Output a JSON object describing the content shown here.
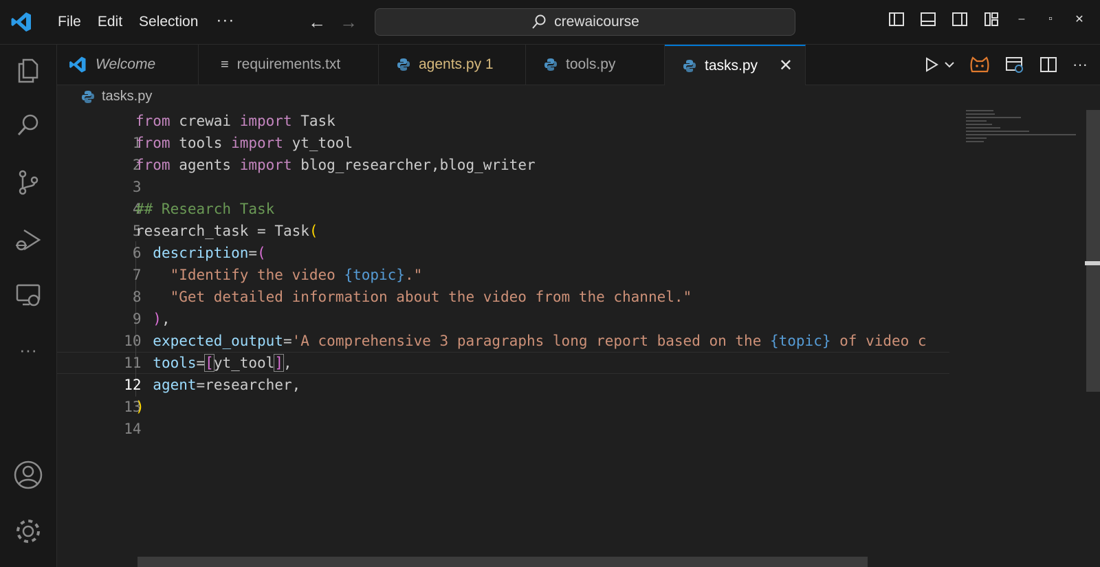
{
  "menu": [
    "File",
    "Edit",
    "Selection"
  ],
  "search": {
    "label": "crewaicourse"
  },
  "tabs": [
    {
      "label": "Welcome"
    },
    {
      "label": "requirements.txt"
    },
    {
      "label": "agents.py 1"
    },
    {
      "label": "tools.py"
    },
    {
      "label": "tasks.py"
    }
  ],
  "breadcrumb": "tasks.py",
  "colors": {
    "accent": "#0078d4",
    "keyword": "#c586c0",
    "string": "#ce9178",
    "comment": "#6a9955",
    "warning_tab": "#d7ba7d",
    "python_icon": "#4a90c2"
  },
  "code": {
    "current_line": 12,
    "line_numbers": [
      "1",
      "2",
      "3",
      "4",
      "5",
      "6",
      "7",
      "8",
      "9",
      "10",
      "11",
      "12",
      "13",
      "14"
    ],
    "lines": [
      {
        "kw1": "from",
        "mod": " crewai ",
        "kw2": "import",
        "name": " Task"
      },
      {
        "kw1": "from",
        "mod": " tools ",
        "kw2": "import",
        "name": " yt_tool"
      },
      {
        "kw1": "from",
        "mod": " agents ",
        "kw2": "import",
        "name": " blog_researcher,blog_writer"
      },
      {},
      {
        "comment": "## Research Task"
      },
      {
        "var": "research_task",
        "op": " = ",
        "call": "Task",
        "paren": "("
      },
      {
        "key": "description",
        "op": "=",
        "paren": "("
      },
      {
        "s1": "\"Identify the video ",
        "ph": "{topic}",
        "s2": ".\""
      },
      {
        "s1": "\"Get detailed information about the video from the channel.\""
      },
      {
        "paren": ")",
        "comma": ","
      },
      {
        "key": "expected_output",
        "op": "=",
        "s1": "'A comprehensive 3 paragraphs long report based on the ",
        "ph": "{topic}",
        "s2": " of video c"
      },
      {
        "key": "tools",
        "op": "=",
        "b1": "[",
        "val": "yt_tool",
        "b2": "]",
        "comma": ","
      },
      {
        "key": "agent",
        "op": "=",
        "val": "researcher",
        "comma": ","
      },
      {
        "paren": ")"
      }
    ]
  }
}
